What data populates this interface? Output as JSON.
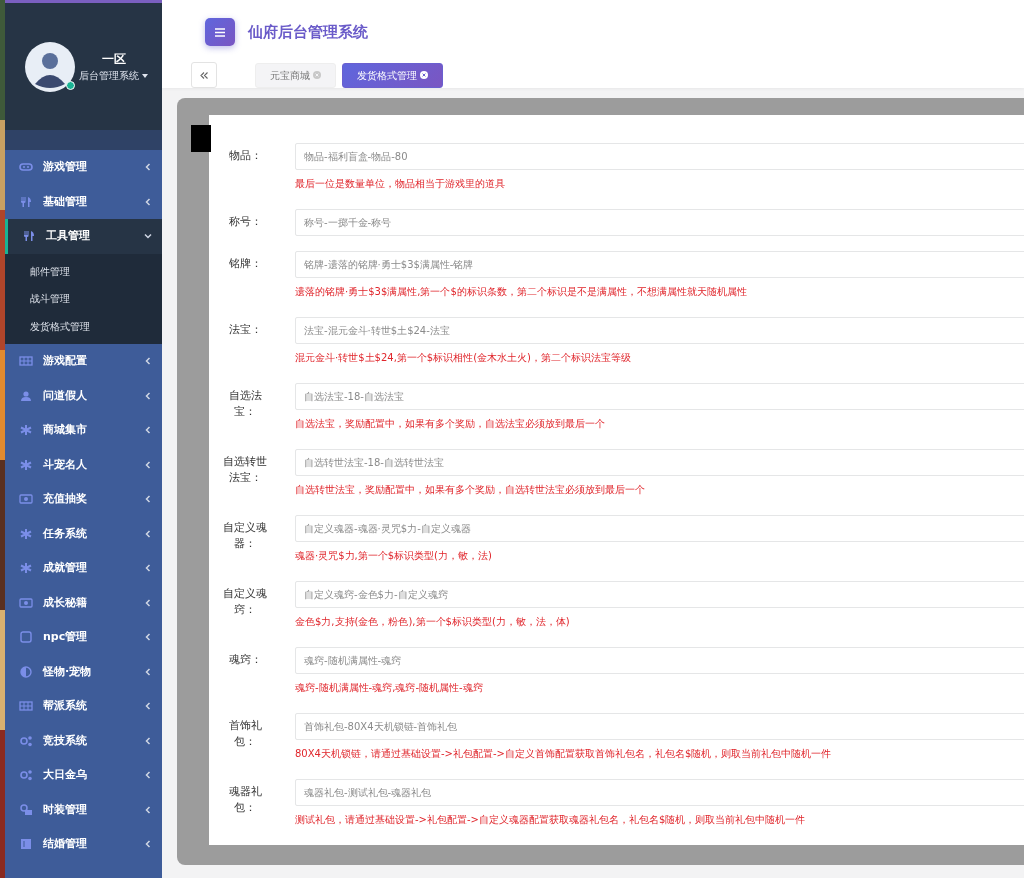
{
  "sidebar": {
    "profile": {
      "name": "一区",
      "subtitle": "后台管理系统",
      "online": true
    },
    "menu": [
      {
        "label": "游戏管理",
        "expanded": false
      },
      {
        "label": "基础管理",
        "expanded": false
      },
      {
        "label": "工具管理",
        "expanded": true,
        "children": [
          {
            "label": "邮件管理"
          },
          {
            "label": "战斗管理"
          },
          {
            "label": "发货格式管理"
          }
        ]
      },
      {
        "label": "游戏配置",
        "expanded": false
      },
      {
        "label": "问道假人",
        "expanded": false
      },
      {
        "label": "商城集市",
        "expanded": false
      },
      {
        "label": "斗宠名人",
        "expanded": false
      },
      {
        "label": "充值抽奖",
        "expanded": false
      },
      {
        "label": "任务系统",
        "expanded": false
      },
      {
        "label": "成就管理",
        "expanded": false
      },
      {
        "label": "成长秘籍",
        "expanded": false
      },
      {
        "label": "npc管理",
        "expanded": false
      },
      {
        "label": "怪物·宠物",
        "expanded": false
      },
      {
        "label": "帮派系统",
        "expanded": false
      },
      {
        "label": "竞技系统",
        "expanded": false
      },
      {
        "label": "大日金乌",
        "expanded": false
      },
      {
        "label": "时装管理",
        "expanded": false
      },
      {
        "label": "结婚管理",
        "expanded": false
      }
    ]
  },
  "header": {
    "title": "仙府后台管理系统",
    "tabs": [
      {
        "label": "元宝商城",
        "selected": false
      },
      {
        "label": "发货格式管理",
        "selected": true
      }
    ]
  },
  "form": {
    "fields": [
      {
        "label": "物品：",
        "placeholder": "物品-福利盲盒-物品-80",
        "hint": "最后一位是数量单位，物品相当于游戏里的道具"
      },
      {
        "label": "称号：",
        "placeholder": "称号-一掷千金-称号"
      },
      {
        "label": "铭牌：",
        "placeholder": "铭牌-遗落的铭牌·勇士$3$满属性-铭牌",
        "hint": "遗落的铭牌·勇士$3$满属性,第一个$的标识条数，第二个标识是不是满属性，不想满属性就天随机属性"
      },
      {
        "label": "法宝：",
        "placeholder": "法宝-混元金斗·转世$土$24-法宝",
        "hint": "混元金斗·转世$土$24,第一个$标识相性(金木水土火)，第二个标识法宝等级"
      },
      {
        "label": "自选法宝：",
        "placeholder": "自选法宝-18-自选法宝",
        "hint": "自选法宝，奖励配置中，如果有多个奖励，自选法宝必须放到最后一个"
      },
      {
        "label": "自选转世法宝：",
        "placeholder": "自选转世法宝-18-自选转世法宝",
        "hint": "自选转世法宝，奖励配置中，如果有多个奖励，自选转世法宝必须放到最后一个"
      },
      {
        "label": "自定义魂器：",
        "placeholder": "自定义魂器-魂器·灵咒$力-自定义魂器",
        "hint": "魂器·灵咒$力,第一个$标识类型(力，敏，法)"
      },
      {
        "label": "自定义魂窍：",
        "placeholder": "自定义魂窍-金色$力-自定义魂窍",
        "hint": "金色$力,支持(金色，粉色),第一个$标识类型(力，敏，法，体)"
      },
      {
        "label": "魂窍：",
        "placeholder": "魂窍-随机满属性-魂窍",
        "hint": "魂窍-随机满属性-魂窍,魂窍-随机属性-魂窍"
      },
      {
        "label": "首饰礼包：",
        "placeholder": "首饰礼包-80X4天机锁链-首饰礼包",
        "hint": "80X4天机锁链，请通过基础设置->礼包配置->自定义首饰配置获取首饰礼包名，礼包名$随机，则取当前礼包中随机一件"
      },
      {
        "label": "魂器礼包：",
        "placeholder": "魂器礼包-测试礼包-魂器礼包",
        "hint": "测试礼包，请通过基础设置->礼包配置->自定义魂器配置获取魂器礼包名，礼包名$随机，则取当前礼包中随机一件"
      }
    ]
  }
}
